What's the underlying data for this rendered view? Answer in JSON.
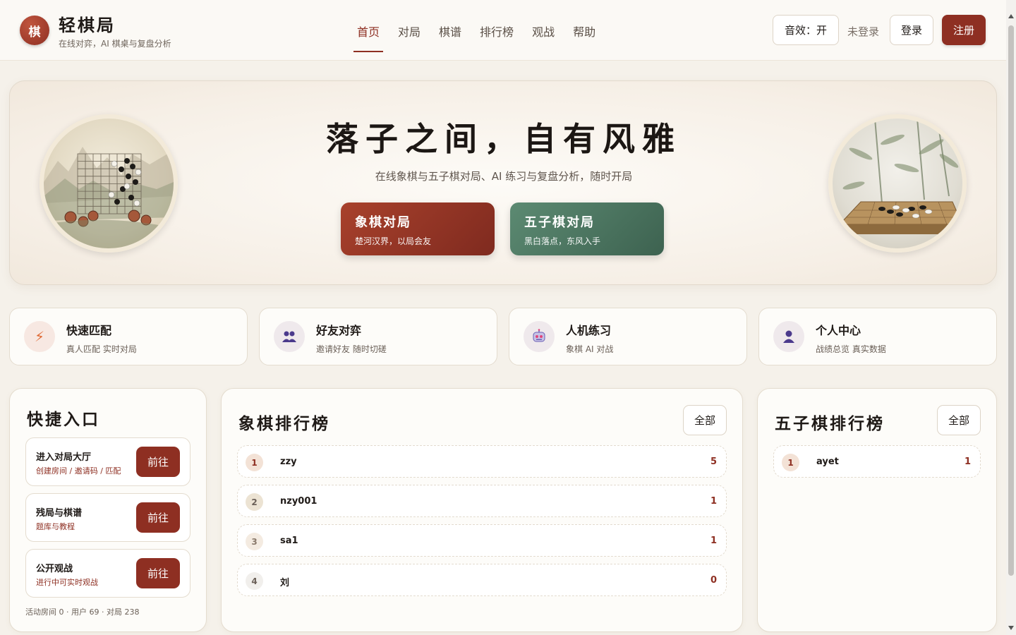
{
  "brand": {
    "logo_char": "棋",
    "title": "轻棋局",
    "subtitle": "在线对弈，AI 棋桌与复盘分析"
  },
  "nav": [
    {
      "label": "首页",
      "active": true
    },
    {
      "label": "对局"
    },
    {
      "label": "棋谱"
    },
    {
      "label": "排行榜"
    },
    {
      "label": "观战"
    },
    {
      "label": "帮助"
    }
  ],
  "header_actions": {
    "sound": "音效：开",
    "login_status": "未登录",
    "login": "登录",
    "register": "注册"
  },
  "hero": {
    "title": "落子之间，自有风雅",
    "subtitle": "在线象棋与五子棋对局、AI 练习与复盘分析，随时开局",
    "xiangqi_btn": {
      "title": "象棋对局",
      "sub": "楚河汉界，以局会友"
    },
    "gomoku_btn": {
      "title": "五子棋对局",
      "sub": "黑白落点，东风入手"
    }
  },
  "features": [
    {
      "title": "快速匹配",
      "sub": "真人匹配 实时对局",
      "icon": "lightning-icon"
    },
    {
      "title": "好友对弈",
      "sub": "邀请好友 随时切磋",
      "icon": "friends-icon"
    },
    {
      "title": "人机练习",
      "sub": "象棋 AI 对战",
      "icon": "robot-icon"
    },
    {
      "title": "个人中心",
      "sub": "战绩总览 真实数据",
      "icon": "user-icon"
    }
  ],
  "shortcuts": {
    "title": "快捷入口",
    "items": [
      {
        "title": "进入对局大厅",
        "sub": "创建房间 / 邀请码 / 匹配",
        "btn": "前往"
      },
      {
        "title": "残局与棋谱",
        "sub": "题库与教程",
        "btn": "前往"
      },
      {
        "title": "公开观战",
        "sub": "进行中可实时观战",
        "btn": "前往"
      }
    ],
    "stats": "活动房间 0 · 用户 69 · 对局 238"
  },
  "xiangqi_rank": {
    "title": "象棋排行榜",
    "all": "全部",
    "rows": [
      {
        "rank": "1",
        "name": "zzy",
        "score": "5"
      },
      {
        "rank": "2",
        "name": "nzy001",
        "score": "1"
      },
      {
        "rank": "3",
        "name": "sa1",
        "score": "1"
      },
      {
        "rank": "4",
        "name": "刘",
        "score": "0"
      }
    ]
  },
  "gomoku_rank": {
    "title": "五子棋排行榜",
    "all": "全部",
    "rows": [
      {
        "rank": "1",
        "name": "ayet",
        "score": "1"
      }
    ]
  },
  "colors": {
    "accent": "#8e2f22",
    "green": "#4a705c",
    "background": "#f5f1ea"
  }
}
